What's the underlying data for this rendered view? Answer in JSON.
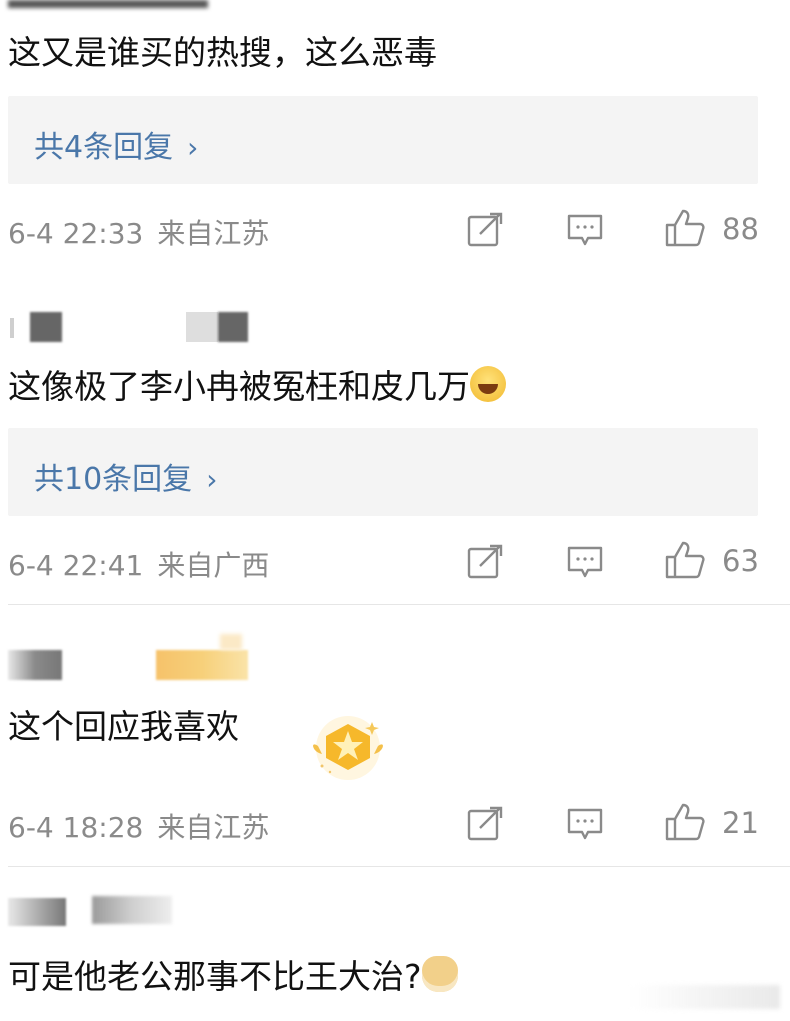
{
  "comments": [
    {
      "user": "",
      "text": "这又是谁买的热搜，这么恶毒",
      "replies": "共4条回复",
      "date": "6-4 22:33",
      "location": "来自江苏",
      "likes": "88"
    },
    {
      "user": "",
      "text": "这像极了李小冉被冤枉和皮几万",
      "emoji": "laugh-emoji",
      "replies": "共10条回复",
      "date": "6-4 22:41",
      "location": "来自广西",
      "likes": "63"
    },
    {
      "user": "",
      "text": "这个回应我喜欢",
      "date": "6-4 18:28",
      "location": "来自江苏",
      "likes": "21"
    },
    {
      "user": "",
      "text": "可是他老公那事不比王大治?",
      "emoji": "doge-emoji"
    }
  ],
  "icons": {
    "repost": "repost-icon",
    "comment": "comment-icon",
    "like": "like-icon"
  },
  "colors": {
    "link": "#4a77a9",
    "meta": "#8a8a8a",
    "reply_bg": "#f4f4f4"
  }
}
